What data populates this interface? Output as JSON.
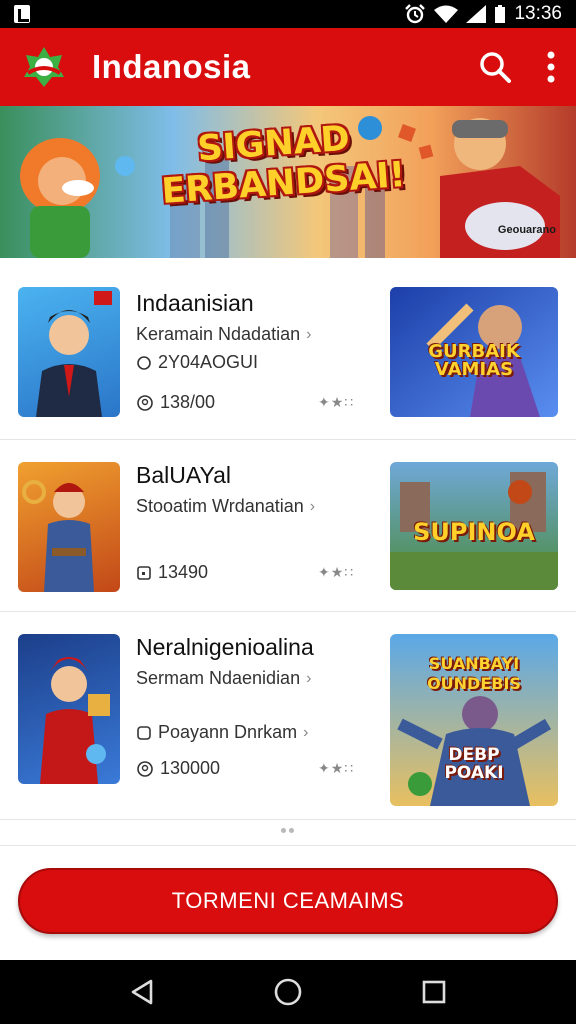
{
  "status": {
    "time": "13:36"
  },
  "app": {
    "title": "Indanosia"
  },
  "banner": {
    "title": "SIGNAD ERBANDSAI!",
    "caption": "Geouarano"
  },
  "games": [
    {
      "title": "Indaanisian",
      "subtitle": "Keramain Ndadatian",
      "meta1": "2Y04AOGUI",
      "meta2": "138/00",
      "preview_text": "GURBAIK VAMIAS"
    },
    {
      "title": "BalUAYal",
      "subtitle": "Stooatim Wrdanatian",
      "meta1": "13490",
      "preview_text": "SUPINOA"
    },
    {
      "title": "Neralnigenioalina",
      "subtitle": "Sermam Ndaenidian",
      "meta1": "Poayann Dnrkam",
      "meta2": "130000",
      "preview_text_1": "SUANBAYI OUNDEBIS",
      "preview_text_2": "DEBP POAKI"
    }
  ],
  "cta": {
    "label": "TORMENI CEAMAIMS"
  },
  "colors": {
    "brand": "#d90d0d",
    "background": "#ffffff"
  }
}
